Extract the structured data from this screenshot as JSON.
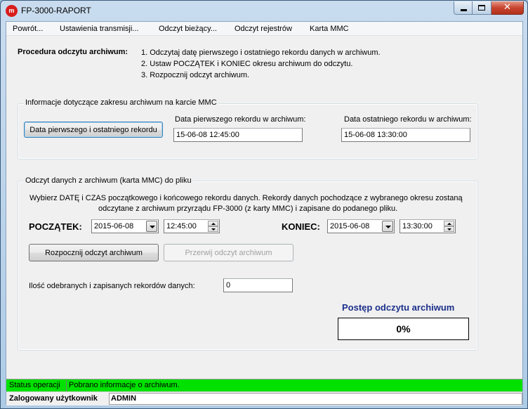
{
  "window": {
    "title": "FP-3000-RAPORT",
    "icon_text": "m"
  },
  "menu": {
    "items": [
      {
        "label": "Powrót..."
      },
      {
        "label": "Ustawienia transmisji..."
      },
      {
        "label": "Odczyt bieżący..."
      },
      {
        "label": "Odczyt rejestrów"
      },
      {
        "label": "Karta MMC"
      }
    ]
  },
  "procedure": {
    "title": "Procedura odczytu archiwum:",
    "steps": [
      "1. Odczytaj datę pierwszego i ostatniego rekordu danych w archiwum.",
      "2. Ustaw POCZĄTEK i KONIEC okresu archiwum do odczytu.",
      "3. Rozpocznij odczyt archiwum."
    ]
  },
  "mmc_info": {
    "legend": "Informacje dotyczące zakresu archiwum na karcie MMC",
    "button_label": "Data pierwszego i ostatniego rekordu",
    "first_label": "Data pierwszego rekordu w archiwum:",
    "first_value": "15-06-08   12:45:00",
    "last_label": "Data ostatniego rekordu w archiwum:",
    "last_value": "15-06-08   13:30:00"
  },
  "read": {
    "legend": "Odczyt danych z archiwum (karta MMC) do pliku",
    "description_line1": "Wybierz DATĘ i CZAS początkowego i końcowego rekordu danych. Rekordy danych pochodzące z wybranego okresu zostaną",
    "description_line2": "odczytane z archiwum przyrządu FP-3000 (z karty MMC) i zapisane do podanego pliku.",
    "start_label": "POCZĄTEK:",
    "start_date": "2015-06-08",
    "start_time": "12:45:00",
    "end_label": "KONIEC:",
    "end_date": "2015-06-08",
    "end_time": "13:30:00",
    "start_button": "Rozpocznij odczyt archiwum",
    "stop_button": "Przerwij odczyt archiwum",
    "count_label": "Ilość odebranych i zapisanych rekordów danych:",
    "count_value": "0",
    "progress_title": "Postęp odczytu archiwum",
    "progress_value": "0%",
    "progress_fraction": 0
  },
  "status": {
    "label": "Status operacji",
    "message": "Pobrano informacje o archiwum.",
    "color": "#00e100"
  },
  "user": {
    "label": "Zalogowany użytkownik",
    "value": "ADMIN"
  }
}
